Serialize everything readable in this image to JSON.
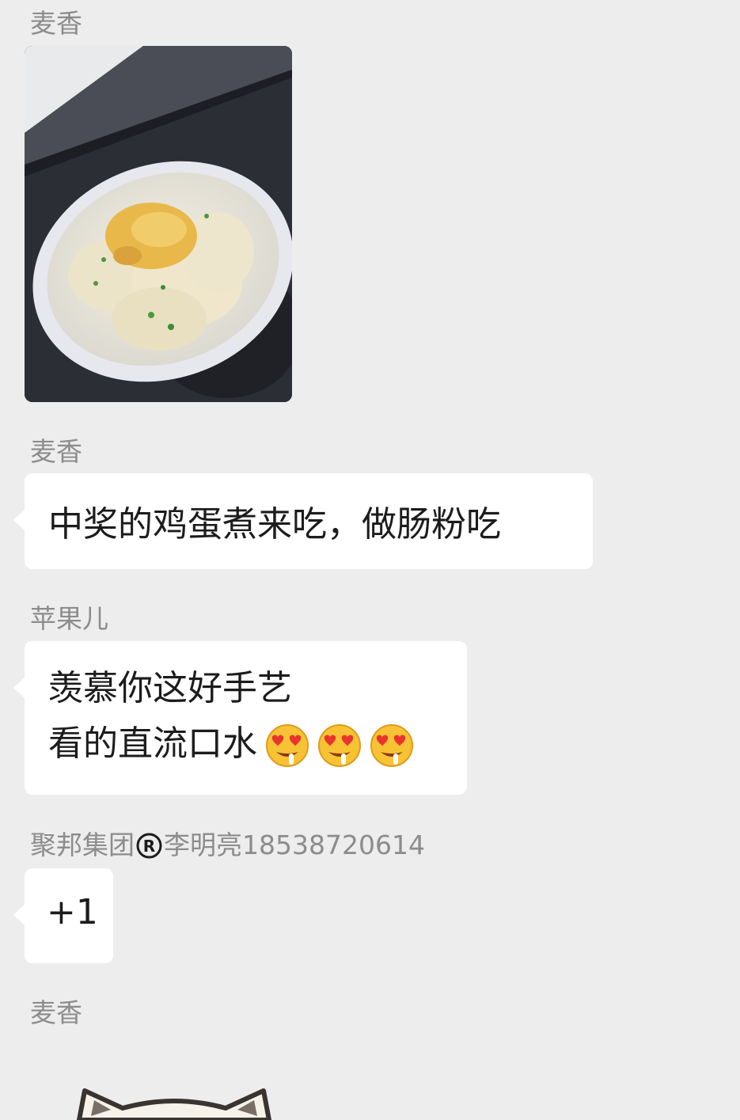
{
  "messages": [
    {
      "sender": "麦香",
      "type": "image",
      "icon": "food-photo-wontons-in-bowl"
    },
    {
      "sender": "麦香",
      "type": "text",
      "text": "中奖的鸡蛋煮来吃，做肠粉吃"
    },
    {
      "sender": "苹果儿",
      "type": "text",
      "line1": "羡慕你这好手艺",
      "line2": "看的直流口水",
      "emoji": "drooling-heart-eyes-emoji"
    },
    {
      "sender_prefix": "聚邦集团",
      "sender_icon": "registered-mark-icon",
      "sender_suffix": "李明亮18538720614",
      "type": "text",
      "text": "+1"
    },
    {
      "sender": "麦香",
      "type": "sticker",
      "icon": "cat-sticker"
    }
  ],
  "colors": {
    "background": "#ededed",
    "bubble": "#ffffff",
    "sender": "#8c8c8c",
    "text": "#1c1c1c"
  }
}
